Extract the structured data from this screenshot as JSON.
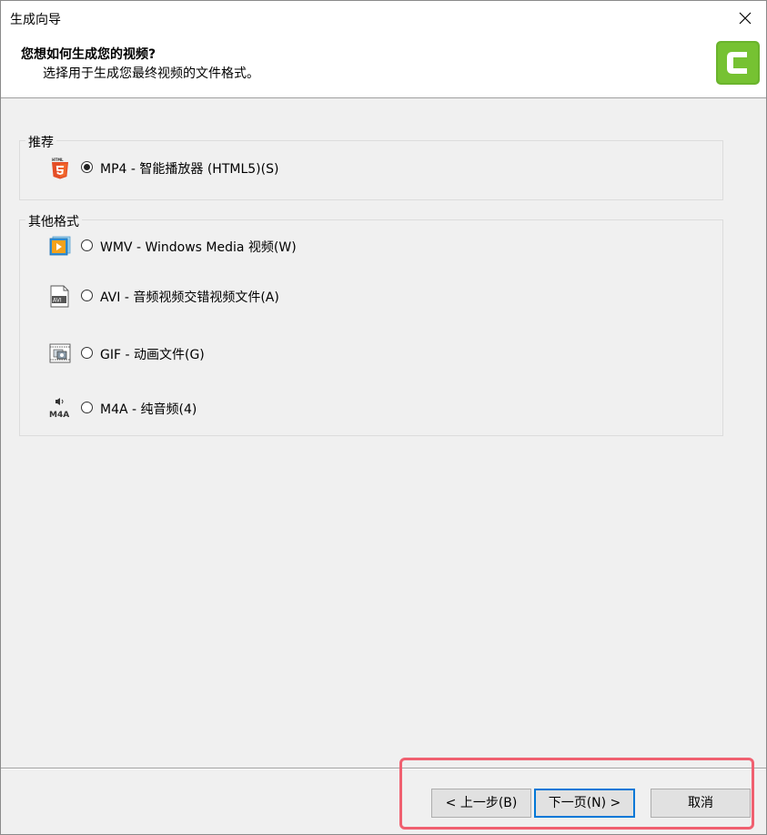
{
  "window": {
    "title": "生成向导"
  },
  "header": {
    "title": "您想如何生成您的视频?",
    "subtitle": "选择用于生成您最终视频的文件格式。"
  },
  "recommended_group": {
    "legend": "推荐",
    "options": [
      {
        "icon": "html5-icon",
        "label": "MP4 - 智能播放器 (HTML5)(S)",
        "checked": true
      }
    ]
  },
  "other_group": {
    "legend": "其他格式",
    "options": [
      {
        "icon": "wmv-icon",
        "label": "WMV - Windows Media 视频(W)",
        "checked": false
      },
      {
        "icon": "avi-icon",
        "label": "AVI - 音频视频交错视频文件(A)",
        "checked": false,
        "icon_text": "AVI"
      },
      {
        "icon": "gif-icon",
        "label": "GIF - 动画文件(G)",
        "checked": false
      },
      {
        "icon": "m4a-icon",
        "label": "M4A - 纯音频(4)",
        "checked": false,
        "icon_text": "M4A"
      }
    ]
  },
  "footer": {
    "back_label": "< 上一步(B)",
    "next_label": "下一页(N) >",
    "cancel_label": "取消"
  },
  "colors": {
    "accent": "#0078d7",
    "logo_green": "#6ab42d",
    "highlight": "#f06070",
    "html5_orange": "#e44d26"
  }
}
